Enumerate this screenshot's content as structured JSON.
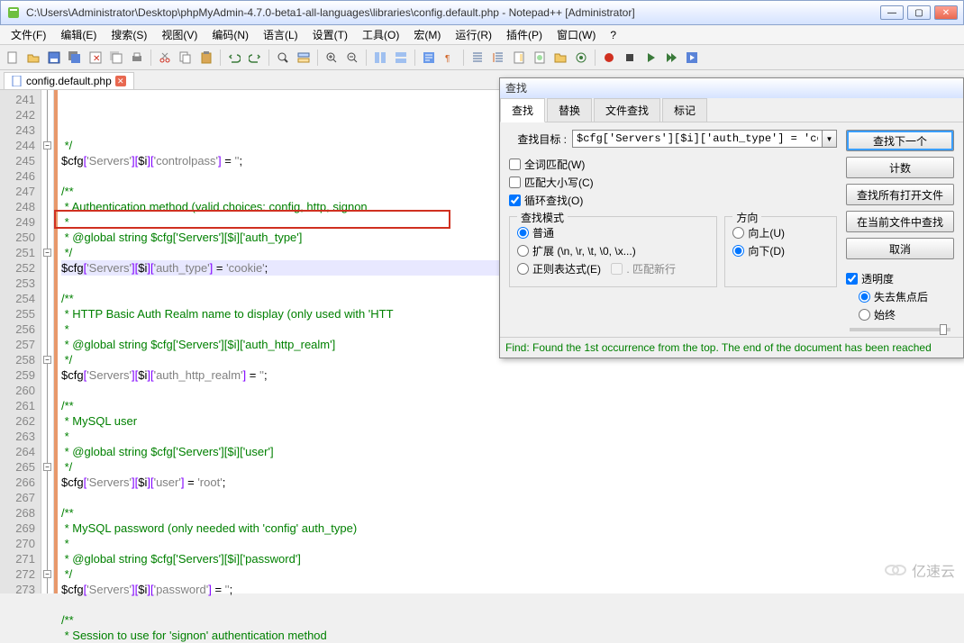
{
  "window": {
    "title": "C:\\Users\\Administrator\\Desktop\\phpMyAdmin-4.7.0-beta1-all-languages\\libraries\\config.default.php - Notepad++ [Administrator]"
  },
  "menu": [
    "文件(F)",
    "编辑(E)",
    "搜索(S)",
    "视图(V)",
    "编码(N)",
    "语言(L)",
    "设置(T)",
    "工具(O)",
    "宏(M)",
    "运行(R)",
    "插件(P)",
    "窗口(W)",
    "?"
  ],
  "tab": {
    "name": "config.default.php"
  },
  "lines": {
    "start": 241,
    "rows": [
      {
        "t": "cm",
        "text": " */"
      },
      {
        "t": "code",
        "parts": [
          "$cfg",
          "[",
          "'Servers'",
          "]",
          "[",
          "$i",
          "]",
          "[",
          "'controlpass'",
          "]",
          " = ",
          "''",
          ";"
        ]
      },
      {
        "t": "blank"
      },
      {
        "t": "cm",
        "text": "/**",
        "fold": true
      },
      {
        "t": "cm",
        "text": " * Authentication method (valid choices: config, http, signon"
      },
      {
        "t": "cm",
        "text": " *"
      },
      {
        "t": "cm",
        "text": " * @global string $cfg['Servers'][$i]['auth_type']"
      },
      {
        "t": "cm",
        "text": " */"
      },
      {
        "t": "hl",
        "parts": [
          "$cfg",
          "[",
          "'Servers'",
          "]",
          "[",
          "$i",
          "]",
          "[",
          "'auth_type'",
          "]",
          " = ",
          "'cookie'",
          ";"
        ]
      },
      {
        "t": "blank"
      },
      {
        "t": "cm",
        "text": "/**",
        "fold": true
      },
      {
        "t": "cm",
        "text": " * HTTP Basic Auth Realm name to display (only used with 'HTT"
      },
      {
        "t": "cm",
        "text": " *"
      },
      {
        "t": "cm",
        "text": " * @global string $cfg['Servers'][$i]['auth_http_realm']"
      },
      {
        "t": "cm",
        "text": " */"
      },
      {
        "t": "code",
        "parts": [
          "$cfg",
          "[",
          "'Servers'",
          "]",
          "[",
          "$i",
          "]",
          "[",
          "'auth_http_realm'",
          "]",
          " = ",
          "''",
          ";"
        ]
      },
      {
        "t": "blank"
      },
      {
        "t": "cm",
        "text": "/**",
        "fold": true
      },
      {
        "t": "cm",
        "text": " * MySQL user"
      },
      {
        "t": "cm",
        "text": " *"
      },
      {
        "t": "cm",
        "text": " * @global string $cfg['Servers'][$i]['user']"
      },
      {
        "t": "cm",
        "text": " */"
      },
      {
        "t": "code",
        "parts": [
          "$cfg",
          "[",
          "'Servers'",
          "]",
          "[",
          "$i",
          "]",
          "[",
          "'user'",
          "]",
          " = ",
          "'root'",
          ";"
        ]
      },
      {
        "t": "blank"
      },
      {
        "t": "cm",
        "text": "/**",
        "fold": true
      },
      {
        "t": "cm",
        "text": " * MySQL password (only needed with 'config' auth_type)"
      },
      {
        "t": "cm",
        "text": " *"
      },
      {
        "t": "cm",
        "text": " * @global string $cfg['Servers'][$i]['password']"
      },
      {
        "t": "cm",
        "text": " */"
      },
      {
        "t": "code",
        "parts": [
          "$cfg",
          "[",
          "'Servers'",
          "]",
          "[",
          "$i",
          "]",
          "[",
          "'password'",
          "]",
          " = ",
          "''",
          ";"
        ]
      },
      {
        "t": "blank"
      },
      {
        "t": "cm",
        "text": "/**",
        "fold": true
      },
      {
        "t": "cm",
        "text": " * Session to use for 'signon' authentication method"
      }
    ]
  },
  "find": {
    "title": "查找",
    "tabs": [
      "查找",
      "替换",
      "文件查找",
      "标记"
    ],
    "target_label": "查找目标 :",
    "target_value": "$cfg['Servers'][$i]['auth_type'] = 'cookie';",
    "buttons": {
      "next": "查找下一个",
      "count": "计数",
      "findall": "查找所有打开文件",
      "inCurrent": "在当前文件中查找",
      "cancel": "取消"
    },
    "checks": {
      "whole": "全词匹配(W)",
      "case": "匹配大小写(C)",
      "wrap": "循环查找(O)"
    },
    "mode": {
      "title": "查找模式",
      "normal": "普通",
      "ext": "扩展 (\\n, \\r, \\t, \\0, \\x...)",
      "regex": "正则表达式(E)",
      "dot": ". 匹配新行"
    },
    "dir": {
      "title": "方向",
      "up": "向上(U)",
      "down": "向下(D)"
    },
    "trans": {
      "check": "透明度",
      "lose": "失去焦点后",
      "always": "始终"
    },
    "status": "Find: Found the 1st occurrence from the top. The end of the document has been reached"
  },
  "watermark": "亿速云"
}
